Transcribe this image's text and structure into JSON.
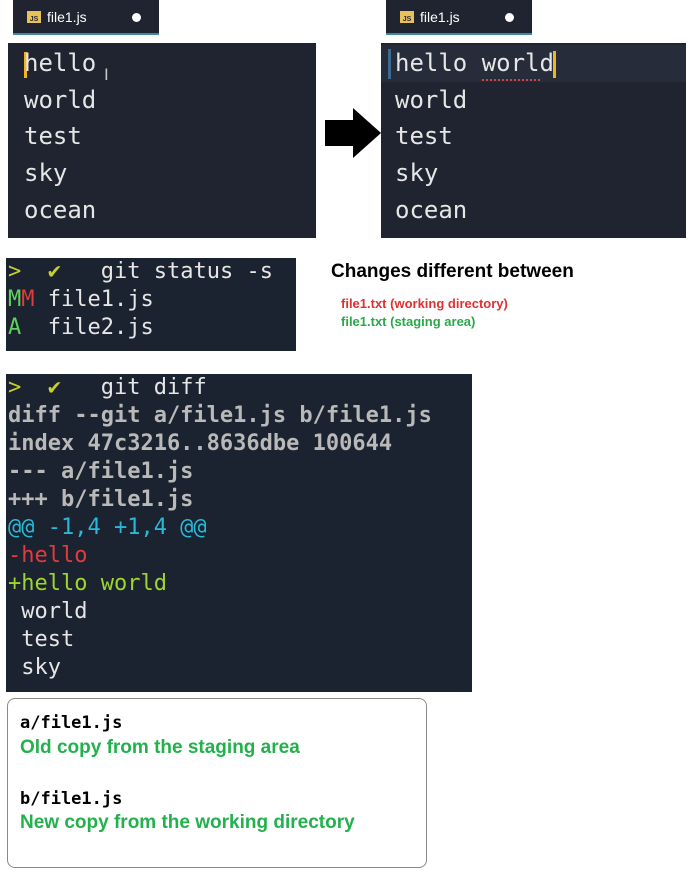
{
  "editor_before": {
    "tab_icon": "JS",
    "tab_name": "file1.js",
    "lines": [
      "hello",
      "world",
      "test",
      "sky",
      "ocean"
    ]
  },
  "editor_after": {
    "tab_icon": "JS",
    "tab_name": "file1.js",
    "lines": [
      "hello world",
      "world",
      "test",
      "sky",
      "ocean"
    ]
  },
  "status_terminal": {
    "prompt_chevron": ">",
    "prompt_check": "✔",
    "command": "git status -s",
    "rows": [
      {
        "x": "M",
        "y": "M",
        "file": "file1.js"
      },
      {
        "x": "A",
        "y": " ",
        "file": "file2.js"
      }
    ]
  },
  "annotation": {
    "title": "Changes different between",
    "working": "file1.txt (working directory)",
    "staging": "file1.txt (staging area)"
  },
  "diff_terminal": {
    "prompt_chevron": ">",
    "prompt_check": "✔",
    "command": "git diff",
    "header": "diff --git a/file1.js b/file1.js",
    "index": "index 47c3216..8636dbe 100644",
    "old_file": "--- a/file1.js",
    "new_file": "+++ b/file1.js",
    "hunk": "@@ -1,4 +1,4 @@",
    "removed": "-hello",
    "added": "+hello world",
    "context": [
      " world",
      " test",
      " sky"
    ]
  },
  "info_box": {
    "a_label": "a/file1.js",
    "a_desc": "Old copy from the staging area",
    "b_label": "b/file1.js",
    "b_desc": "New copy from the working directory"
  },
  "colors": {
    "editor_bg": "#1f2430",
    "cursor": "#f5b31b",
    "added_green": "#9fd62d",
    "removed_red": "#e23b3b",
    "hunk_cyan": "#29b8d6",
    "anno_red": "#e03030",
    "anno_green": "#2aa84a"
  }
}
